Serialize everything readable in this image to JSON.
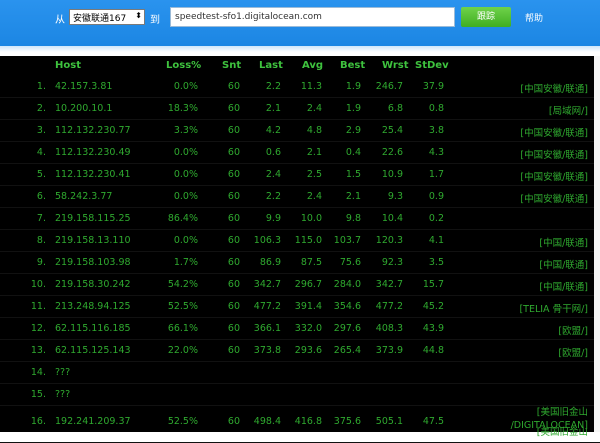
{
  "toolbar": {
    "from_label": "从",
    "node_selected": "安徽联通167",
    "select_arrow": "⬍",
    "to_label": "到",
    "target_value": "speedtest-sfo1.digitalocean.com",
    "trace_button": "跟踪",
    "help_link": "帮助"
  },
  "table": {
    "headers": {
      "host": "Host",
      "loss": "Loss%",
      "snt": "Snt",
      "last": "Last",
      "avg": "Avg",
      "best": "Best",
      "wrst": "Wrst",
      "stdev": "StDev"
    },
    "rows": [
      {
        "num": "1.",
        "host": "42.157.3.81",
        "loss": "0.0%",
        "snt": "60",
        "last": "2.2",
        "avg": "11.3",
        "best": "1.9",
        "wrst": "246.7",
        "stdev": "37.9",
        "loc": "[中国安徽/联通]"
      },
      {
        "num": "2.",
        "host": "10.200.10.1",
        "loss": "18.3%",
        "snt": "60",
        "last": "2.1",
        "avg": "2.4",
        "best": "1.9",
        "wrst": "6.8",
        "stdev": "0.8",
        "loc": "[局域网/]"
      },
      {
        "num": "3.",
        "host": "112.132.230.77",
        "loss": "3.3%",
        "snt": "60",
        "last": "4.2",
        "avg": "4.8",
        "best": "2.9",
        "wrst": "25.4",
        "stdev": "3.8",
        "loc": "[中国安徽/联通]"
      },
      {
        "num": "4.",
        "host": "112.132.230.49",
        "loss": "0.0%",
        "snt": "60",
        "last": "0.6",
        "avg": "2.1",
        "best": "0.4",
        "wrst": "22.6",
        "stdev": "4.3",
        "loc": "[中国安徽/联通]"
      },
      {
        "num": "5.",
        "host": "112.132.230.41",
        "loss": "0.0%",
        "snt": "60",
        "last": "2.4",
        "avg": "2.5",
        "best": "1.5",
        "wrst": "10.9",
        "stdev": "1.7",
        "loc": "[中国安徽/联通]"
      },
      {
        "num": "6.",
        "host": "58.242.3.77",
        "loss": "0.0%",
        "snt": "60",
        "last": "2.2",
        "avg": "2.4",
        "best": "2.1",
        "wrst": "9.3",
        "stdev": "0.9",
        "loc": "[中国安徽/联通]"
      },
      {
        "num": "7.",
        "host": "219.158.115.25",
        "loss": "86.4%",
        "snt": "60",
        "last": "9.9",
        "avg": "10.0",
        "best": "9.8",
        "wrst": "10.4",
        "stdev": "0.2",
        "loc": ""
      },
      {
        "num": "8.",
        "host": "219.158.13.110",
        "loss": "0.0%",
        "snt": "60",
        "last": "106.3",
        "avg": "115.0",
        "best": "103.7",
        "wrst": "120.3",
        "stdev": "4.1",
        "loc": "[中国/联通]"
      },
      {
        "num": "9.",
        "host": "219.158.103.98",
        "loss": "1.7%",
        "snt": "60",
        "last": "86.9",
        "avg": "87.5",
        "best": "75.6",
        "wrst": "92.3",
        "stdev": "3.5",
        "loc": "[中国/联通]"
      },
      {
        "num": "10.",
        "host": "219.158.30.242",
        "loss": "54.2%",
        "snt": "60",
        "last": "342.7",
        "avg": "296.7",
        "best": "284.0",
        "wrst": "342.7",
        "stdev": "15.7",
        "loc": "[中国/联通]"
      },
      {
        "num": "11.",
        "host": "213.248.94.125",
        "loss": "52.5%",
        "snt": "60",
        "last": "477.2",
        "avg": "391.4",
        "best": "354.6",
        "wrst": "477.2",
        "stdev": "45.2",
        "loc": "[TELIA 骨干网/]"
      },
      {
        "num": "12.",
        "host": "62.115.116.185",
        "loss": "66.1%",
        "snt": "60",
        "last": "366.1",
        "avg": "332.0",
        "best": "297.6",
        "wrst": "408.3",
        "stdev": "43.9",
        "loc": "[欧盟/]"
      },
      {
        "num": "13.",
        "host": "62.115.125.143",
        "loss": "22.0%",
        "snt": "60",
        "last": "373.8",
        "avg": "293.6",
        "best": "265.4",
        "wrst": "373.9",
        "stdev": "44.8",
        "loc": "[欧盟/]"
      },
      {
        "num": "14.",
        "host": "???",
        "loss": "",
        "snt": "",
        "last": "",
        "avg": "",
        "best": "",
        "wrst": "",
        "stdev": "",
        "loc": ""
      },
      {
        "num": "15.",
        "host": "???",
        "loss": "",
        "snt": "",
        "last": "",
        "avg": "",
        "best": "",
        "wrst": "",
        "stdev": "",
        "loc": ""
      },
      {
        "num": "16.",
        "host": "192.241.209.37",
        "loss": "52.5%",
        "snt": "60",
        "last": "498.4",
        "avg": "416.8",
        "best": "375.6",
        "wrst": "505.1",
        "stdev": "47.5",
        "loc": "[美国旧金山",
        "loc2": "/DIGITALOCEAN]"
      }
    ],
    "partial_next_loc": "[美国旧金山"
  },
  "colors": {
    "header_bar": "#1c86e3",
    "table_bg": "#000000",
    "table_text": "#2fa92f",
    "button": "#3fae22"
  }
}
